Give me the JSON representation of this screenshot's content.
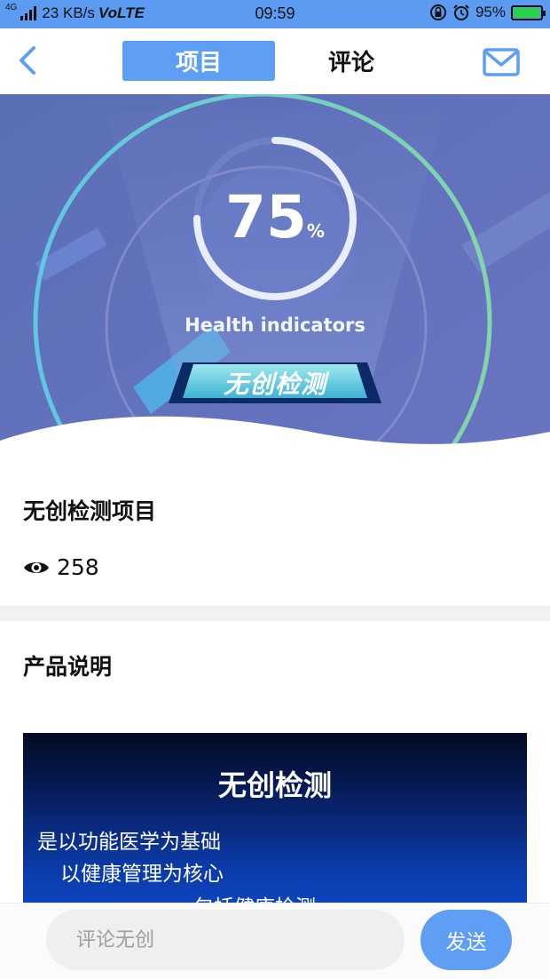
{
  "status_bar": {
    "network_type": "4G",
    "speed": "23 KB/s",
    "volte": "VoLTE",
    "time": "09:59",
    "battery": "95%",
    "battery_level": 0.95,
    "icons": [
      "signal-icon",
      "lock-rotation-icon",
      "alarm-icon",
      "battery-icon"
    ]
  },
  "nav": {
    "back_icon": "chevron-left-icon",
    "tabs": [
      {
        "label": "项目",
        "active": true
      },
      {
        "label": "评论",
        "active": false
      }
    ],
    "mail_icon": "mail-icon"
  },
  "banner": {
    "percent": "75",
    "percent_unit": "%",
    "progress": 0.75,
    "caption": "Health indicators",
    "badge": "无创检测"
  },
  "product": {
    "title": "无创检测项目",
    "view_icon": "eye-icon",
    "views": "258"
  },
  "description": {
    "title": "产品说明",
    "slide": {
      "title": "无创检测",
      "lines": [
        "是以功能医学为基础",
        "以健康管理为核心",
        "包括健康检测"
      ]
    }
  },
  "comment": {
    "placeholder": "评论无创",
    "send_label": "发送"
  },
  "colors": {
    "accent": "#5e9ef4",
    "banner_bg": "#5f75bd",
    "divider": "#f1f1f1"
  }
}
